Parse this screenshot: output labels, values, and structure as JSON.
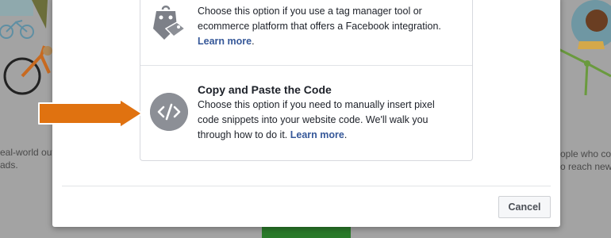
{
  "background": {
    "left_text_line1": "eal-world outc",
    "left_text_line2": "ads.",
    "right_text_line1": "ople who cor",
    "right_text_line2": "o reach new"
  },
  "modal": {
    "option_partner": {
      "description": "Choose this option if you use a tag manager tool or ecommerce platform that offers a Facebook integration.",
      "link": "Learn more",
      "link_suffix": "."
    },
    "option_code": {
      "title": "Copy and Paste the Code",
      "description": "Choose this option if you need to manually insert pixel code snippets into your website code. We'll walk you through how to do it.",
      "link": "Learn more",
      "link_suffix": "."
    },
    "cancel_label": "Cancel"
  },
  "colors": {
    "arrow": "#e07210",
    "icon_gray": "#8c8f96",
    "link": "#365899"
  }
}
